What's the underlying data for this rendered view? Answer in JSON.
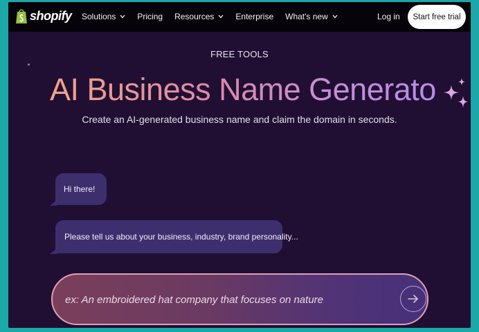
{
  "colors": {
    "nav_background": "#06040a",
    "page_background": "#200f33",
    "bubble_background": "#3d2f6e",
    "cta_background": "#ffffff",
    "headline_gradient_start": "#f2a488",
    "headline_gradient_end": "#b88be6",
    "frame_border": "#1aa8a8"
  },
  "nav": {
    "logo_text": "shopify",
    "logo_icon": "shopping-bag-icon",
    "items": [
      {
        "label": "Solutions",
        "has_dropdown": true
      },
      {
        "label": "Pricing",
        "has_dropdown": false
      },
      {
        "label": "Resources",
        "has_dropdown": true
      },
      {
        "label": "Enterprise",
        "has_dropdown": false
      },
      {
        "label": "What's new",
        "has_dropdown": true
      }
    ],
    "login_label": "Log in",
    "cta_label": "Start free trial"
  },
  "hero": {
    "eyebrow": "FREE TOOLS",
    "title": "AI Business Name Generator",
    "subtitle": "Create an AI-generated business name and claim the domain in seconds.",
    "decoration_icon": "sparkle-icon"
  },
  "chat": {
    "messages": [
      {
        "text": "Hi there!"
      },
      {
        "text": "Please tell us about your business, industry, brand personality..."
      }
    ]
  },
  "prompt": {
    "placeholder": "ex: An embroidered hat company that focuses on nature",
    "value": "",
    "submit_icon": "arrow-right-icon"
  }
}
